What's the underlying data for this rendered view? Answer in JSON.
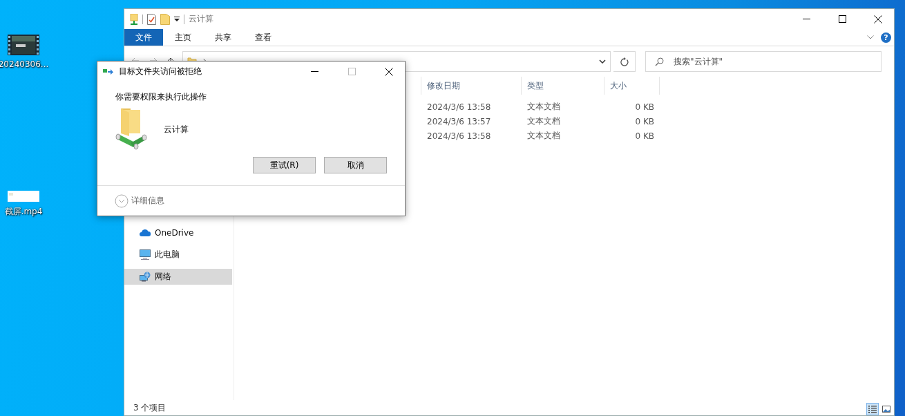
{
  "desktop_icons": [
    {
      "label": "20240306...",
      "kind": "video"
    },
    {
      "label": "截屏.mp4",
      "kind": "screenshot"
    }
  ],
  "explorer": {
    "title": "云计算",
    "ribbon_tabs": [
      {
        "label": "文件",
        "selected": true
      },
      {
        "label": "主页",
        "selected": false
      },
      {
        "label": "共享",
        "selected": false
      },
      {
        "label": "查看",
        "selected": false
      }
    ],
    "help_button": "?",
    "search": {
      "placeholder": "搜索\"云计算\""
    },
    "sidebar": [
      {
        "label": "OneDrive",
        "kind": "cloud",
        "selected": false
      },
      {
        "label": "此电脑",
        "kind": "pc",
        "selected": false
      },
      {
        "label": "网络",
        "kind": "network",
        "selected": true
      }
    ],
    "columns": [
      "修改日期",
      "类型",
      "大小"
    ],
    "rows": [
      {
        "modified": "2024/3/6 13:58",
        "type": "文本文档",
        "size": "0 KB"
      },
      {
        "modified": "2024/3/6 13:57",
        "type": "文本文档",
        "size": "0 KB"
      },
      {
        "modified": "2024/3/6 13:58",
        "type": "文本文档",
        "size": "0 KB"
      }
    ],
    "status": "3 个项目",
    "view_buttons": [
      {
        "kind": "details",
        "selected": true
      },
      {
        "kind": "large_icons",
        "selected": false
      }
    ]
  },
  "dialog": {
    "title": "目标文件夹访问被拒绝",
    "message": "你需要权限来执行此操作",
    "folder_name": "云计算",
    "buttons": [
      "重试(R)",
      "取消"
    ],
    "details": {
      "label": "详细信息",
      "expanded": false
    }
  }
}
